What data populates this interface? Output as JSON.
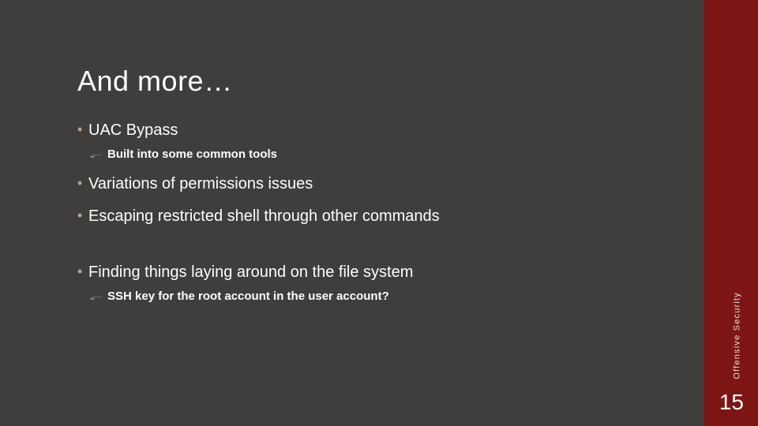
{
  "title": "And more…",
  "bullets": {
    "b0": "UAC Bypass",
    "b0_sub": "Built into some common tools",
    "b1": "Variations of permissions issues",
    "b2": "Escaping restricted shell through other commands",
    "b3": "Finding things laying around on the file system",
    "b3_sub": "SSH key for the root account in the user account?"
  },
  "side_label": "Offensive Security",
  "page_number": "15"
}
